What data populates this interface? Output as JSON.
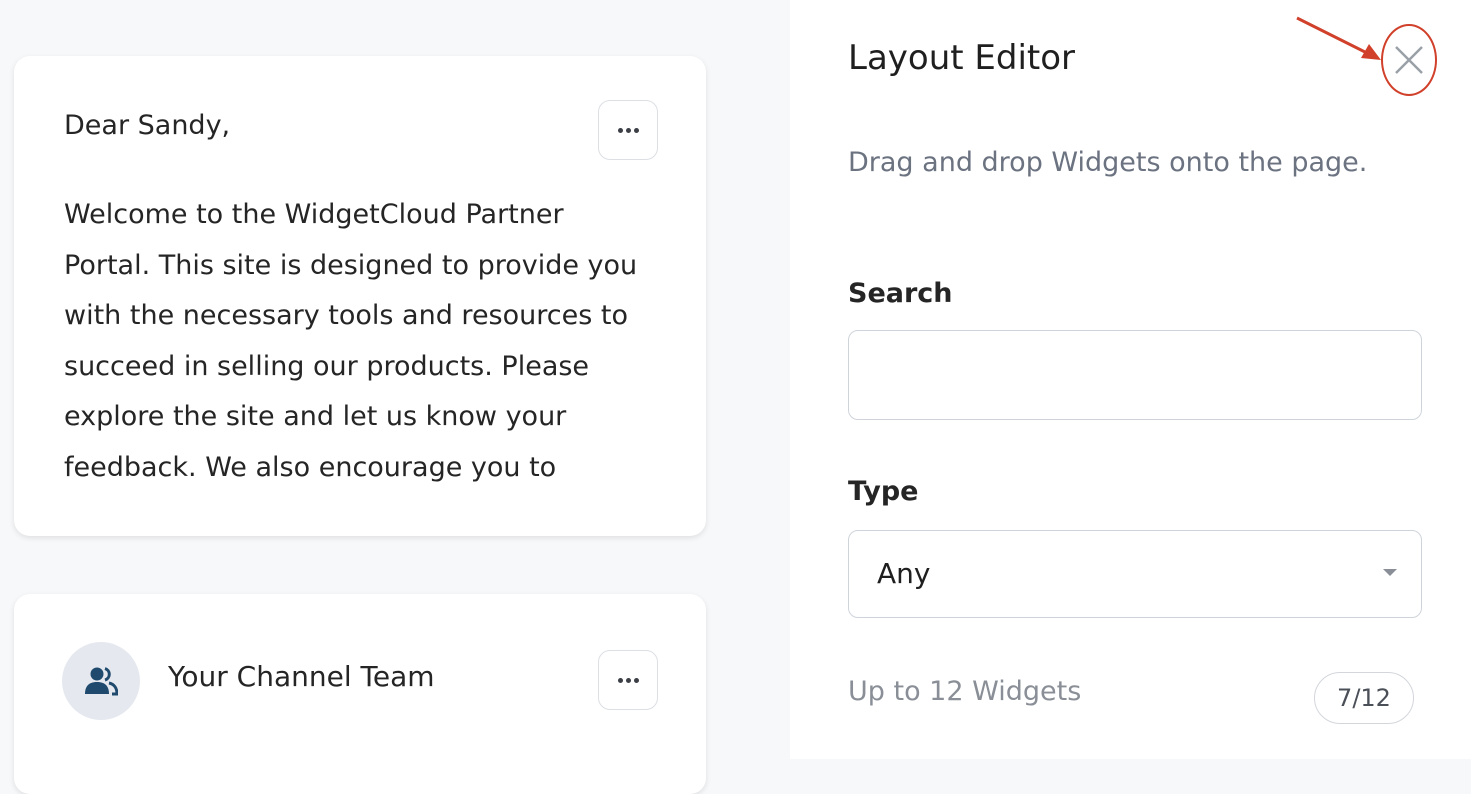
{
  "welcome_card": {
    "greeting": "Dear Sandy,",
    "body": "Welcome to the WidgetCloud Partner Portal. This site is designed to provide you with the necessary tools and resources to succeed in selling our products. Please explore the site and let us know your feedback. We also encourage you to",
    "menu_icon": "more-horizontal-icon"
  },
  "team_card": {
    "title": "Your Channel Team",
    "avatar_icon": "users-icon",
    "menu_icon": "more-horizontal-icon"
  },
  "layout_editor": {
    "title": "Layout Editor",
    "close_icon": "close-icon",
    "description": "Drag and drop Widgets onto the page.",
    "search": {
      "label": "Search",
      "value": "",
      "placeholder": ""
    },
    "type": {
      "label": "Type",
      "selected": "Any",
      "caret_icon": "caret-down-icon"
    },
    "limit_text": "Up to 12 Widgets",
    "limit_badge": "7/12"
  },
  "colors": {
    "annotation": "#d0402a",
    "avatar_icon": "#1f4a6e",
    "muted_text": "#6b7280"
  }
}
